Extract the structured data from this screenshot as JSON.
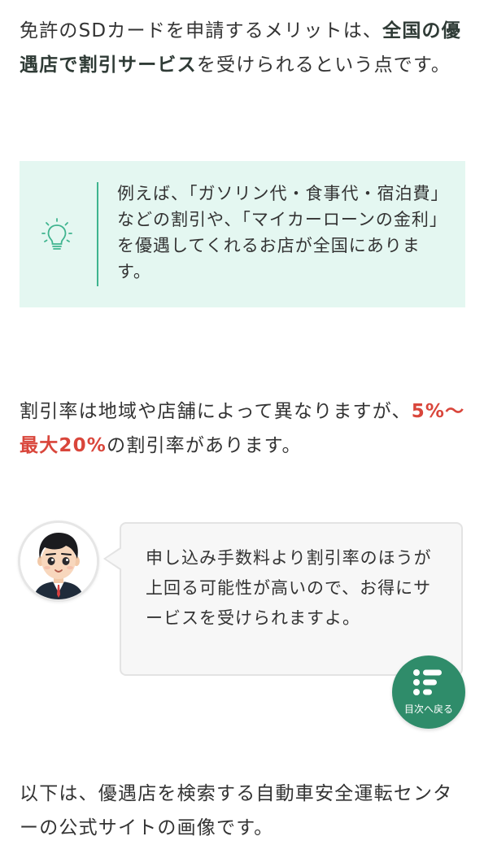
{
  "intro": {
    "part1": "免許のSDカードを申請するメリットは、",
    "bold": "全国の優遇店で割引サービス",
    "part2": "を受けられるという点です。"
  },
  "tip_box": {
    "icon": "lightbulb-icon",
    "text": "例えば、「ガソリン代・食事代・宿泊費」などの割引や、「マイカーローンの金利」を優遇してくれるお店が全国にあります。"
  },
  "discount": {
    "part1": "割引率は地域や店舗によって異なりますが、",
    "highlight": "5%〜最大20%",
    "part2": "の割引率があります。"
  },
  "speech": {
    "avatar": "person-avatar",
    "text": "申し込み手数料より割引率のほうが上回る可能性が高いので、お得にサービスを受けられますよ。"
  },
  "toc_button": {
    "icon": "list-icon",
    "label": "目次へ戻る"
  },
  "outro": {
    "text": "以下は、優遇店を検索する自動車安全運転センターの公式サイトの画像です。"
  },
  "colors": {
    "accent_green": "#2f8c6a",
    "tip_background": "#e4f7f1",
    "highlight_red": "#d9463b"
  }
}
